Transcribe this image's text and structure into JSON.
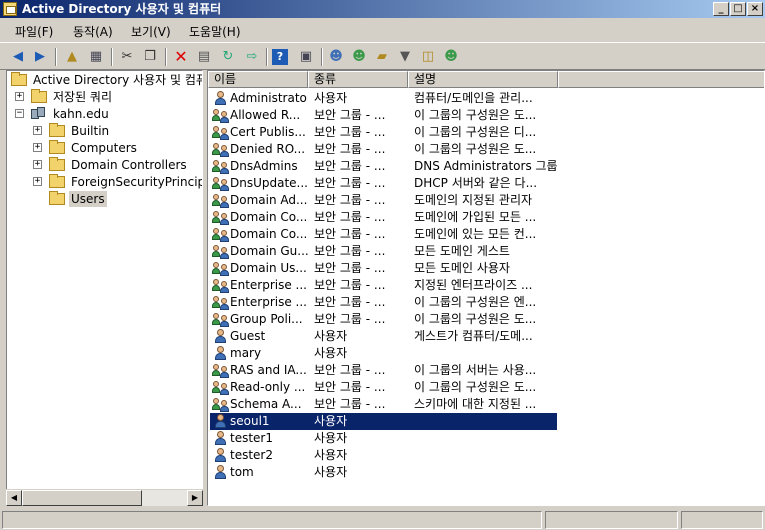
{
  "window": {
    "title": "Active Directory 사용자 및 컴퓨터",
    "controls": [
      "minimize",
      "maximize",
      "close"
    ]
  },
  "menu": [
    "파일(F)",
    "동작(A)",
    "보기(V)",
    "도움말(H)"
  ],
  "toolbar": {
    "buttons": [
      "back-icon",
      "forward-icon",
      "up-folder-icon",
      "show-hide-tree-icon",
      "cut-icon",
      "copy-icon",
      "delete-icon",
      "properties-icon",
      "refresh-icon",
      "export-list-icon",
      "help-icon",
      "show-console-tree-icon",
      "new-user-icon",
      "new-group-icon",
      "new-ou-icon",
      "filter-icon",
      "find-icon",
      "add-to-group-icon"
    ]
  },
  "tree": {
    "root": "Active Directory 사용자 및 컴퓨터 [",
    "saved_queries": "저장된 쿼리",
    "domain": "kahn.edu",
    "children": [
      "Builtin",
      "Computers",
      "Domain Controllers",
      "ForeignSecurityPrincipals",
      "Users"
    ],
    "selected": "Users"
  },
  "list": {
    "columns": [
      "이름",
      "종류",
      "설명"
    ],
    "rows": [
      {
        "name": "Administrator",
        "type": "사용자",
        "desc": "컴퓨터/도메인을 관리...",
        "icon": "user-icon"
      },
      {
        "name": "Allowed R...",
        "type": "보안 그룹 - ...",
        "desc": "이 그룹의 구성원은 도...",
        "icon": "group-icon"
      },
      {
        "name": "Cert Publis...",
        "type": "보안 그룹 - ...",
        "desc": "이 그룹의 구성원은 디...",
        "icon": "group-icon"
      },
      {
        "name": "Denied RO...",
        "type": "보안 그룹 - ...",
        "desc": "이 그룹의 구성원은 도...",
        "icon": "group-icon"
      },
      {
        "name": "DnsAdmins",
        "type": "보안 그룹 - ...",
        "desc": "DNS Administrators 그룹",
        "icon": "group-icon"
      },
      {
        "name": "DnsUpdate...",
        "type": "보안 그룹 - ...",
        "desc": "DHCP 서버와 같은 다...",
        "icon": "group-icon"
      },
      {
        "name": "Domain Ad...",
        "type": "보안 그룹 - ...",
        "desc": "도메인의 지정된 관리자",
        "icon": "group-icon"
      },
      {
        "name": "Domain Co...",
        "type": "보안 그룹 - ...",
        "desc": "도메인에 가입된 모든 ...",
        "icon": "group-icon"
      },
      {
        "name": "Domain Co...",
        "type": "보안 그룹 - ...",
        "desc": "도메인에 있는 모든 컨...",
        "icon": "group-icon"
      },
      {
        "name": "Domain Gu...",
        "type": "보안 그룹 - ...",
        "desc": "모든 도메인 게스트",
        "icon": "group-icon"
      },
      {
        "name": "Domain Us...",
        "type": "보안 그룹 - ...",
        "desc": "모든 도메인 사용자",
        "icon": "group-icon"
      },
      {
        "name": "Enterprise ...",
        "type": "보안 그룹 - ...",
        "desc": "지정된 엔터프라이즈 ...",
        "icon": "group-icon"
      },
      {
        "name": "Enterprise ...",
        "type": "보안 그룹 - ...",
        "desc": "이 그룹의 구성원은 엔...",
        "icon": "group-icon"
      },
      {
        "name": "Group Poli...",
        "type": "보안 그룹 - ...",
        "desc": "이 그룹의 구성원은 도...",
        "icon": "group-icon"
      },
      {
        "name": "Guest",
        "type": "사용자",
        "desc": "게스트가 컴퓨터/도메...",
        "icon": "user-icon"
      },
      {
        "name": "mary",
        "type": "사용자",
        "desc": "",
        "icon": "user-icon"
      },
      {
        "name": "RAS and IA...",
        "type": "보안 그룹 - ...",
        "desc": "이 그룹의 서버는 사용...",
        "icon": "group-icon"
      },
      {
        "name": "Read-only ...",
        "type": "보안 그룹 - ...",
        "desc": "이 그룹의 구성원은 도...",
        "icon": "group-icon"
      },
      {
        "name": "Schema A...",
        "type": "보안 그룹 - ...",
        "desc": "스키마에 대한 지정된 ...",
        "icon": "group-icon"
      },
      {
        "name": "seoul1",
        "type": "사용자",
        "desc": "",
        "icon": "user-icon",
        "selected": true
      },
      {
        "name": "tester1",
        "type": "사용자",
        "desc": "",
        "icon": "user-icon"
      },
      {
        "name": "tester2",
        "type": "사용자",
        "desc": "",
        "icon": "user-icon"
      },
      {
        "name": "tom",
        "type": "사용자",
        "desc": "",
        "icon": "user-icon"
      }
    ]
  },
  "colors": {
    "title_start": "#0a246a",
    "title_end": "#a6caf0",
    "selection": "#0a246a",
    "chrome": "#d4d0c8"
  }
}
